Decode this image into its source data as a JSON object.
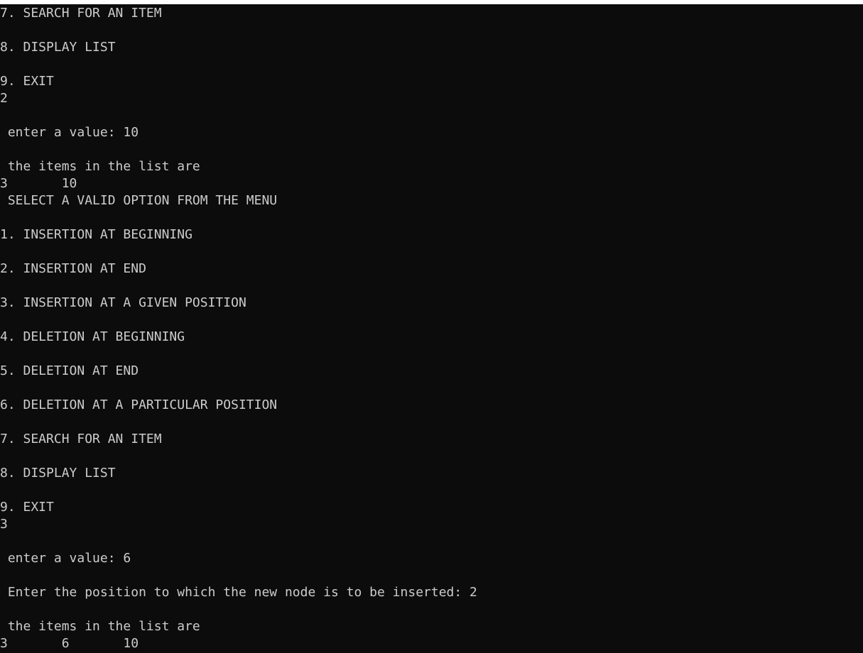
{
  "terminal": {
    "lines": [
      "7. SEARCH FOR AN ITEM",
      "",
      "8. DISPLAY LIST",
      "",
      "9. EXIT",
      "2",
      "",
      " enter a value: 10",
      "",
      " the items in the list are",
      "3       10",
      " SELECT A VALID OPTION FROM THE MENU",
      "",
      "1. INSERTION AT BEGINNING",
      "",
      "2. INSERTION AT END",
      "",
      "3. INSERTION AT A GIVEN POSITION",
      "",
      "4. DELETION AT BEGINNING",
      "",
      "5. DELETION AT END",
      "",
      "6. DELETION AT A PARTICULAR POSITION",
      "",
      "7. SEARCH FOR AN ITEM",
      "",
      "8. DISPLAY LIST",
      "",
      "9. EXIT",
      "3",
      "",
      " enter a value: 6",
      "",
      " Enter the position to which the new node is to be inserted: 2",
      "",
      " the items in the list are",
      "3       6       10"
    ]
  }
}
